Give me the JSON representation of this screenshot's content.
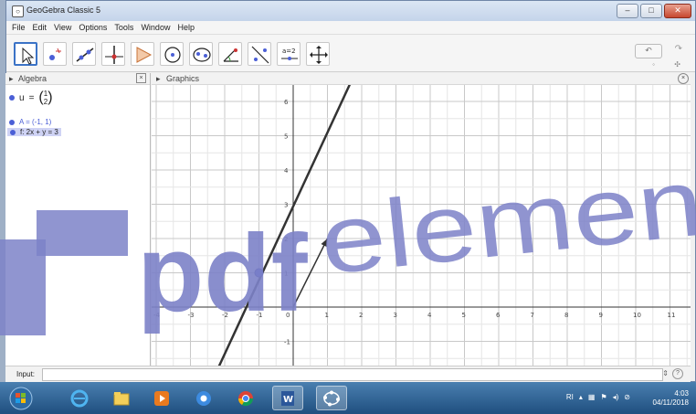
{
  "window": {
    "title": "GeoGebra Classic 5",
    "min_label": "–",
    "max_label": "□",
    "close_label": "✕"
  },
  "menu": [
    "File",
    "Edit",
    "View",
    "Options",
    "Tools",
    "Window",
    "Help"
  ],
  "toolbar": {
    "tools": [
      "move-tool",
      "point-tool",
      "line-tool",
      "perpendicular-line-tool",
      "polygon-tool",
      "circle-tool",
      "ellipse-tool",
      "angle-tool",
      "reflect-tool",
      "slider-tool",
      "move-graphics-tool"
    ],
    "undo_label": "↶",
    "redo_label": "↷"
  },
  "algebra": {
    "header": "Algebra",
    "items": [
      {
        "text": "u = (1, 2)",
        "vector": {
          "name": "u",
          "top": "1",
          "bottom": "2"
        }
      },
      {
        "text": "A = (-1, 1)"
      },
      {
        "text": "f: 2x + y = 3"
      }
    ]
  },
  "graphics": {
    "header": "Graphics",
    "x_ticks": [
      "-4",
      "-3",
      "-2",
      "-1",
      "0",
      "1",
      "2",
      "3",
      "4",
      "5",
      "6",
      "7",
      "8",
      "9",
      "10",
      "11"
    ],
    "y_ticks": [
      "-1",
      "1",
      "2",
      "3",
      "4",
      "5",
      "6",
      "8"
    ],
    "line_label": "f"
  },
  "input": {
    "label": "Input:",
    "value": ""
  },
  "taskbar": {
    "apps": [
      "windows-start",
      "internet-explorer",
      "file-explorer",
      "media-player",
      "chrome-blue",
      "chrome",
      "word",
      "geogebra"
    ],
    "tray_lang": "RI",
    "time": "4:03",
    "date": "04/11/2018"
  },
  "watermark": "pdfelement",
  "colors": {
    "accent": "#3b73c6",
    "point": "#4b5fd6",
    "watermark": "#7d82c8"
  }
}
